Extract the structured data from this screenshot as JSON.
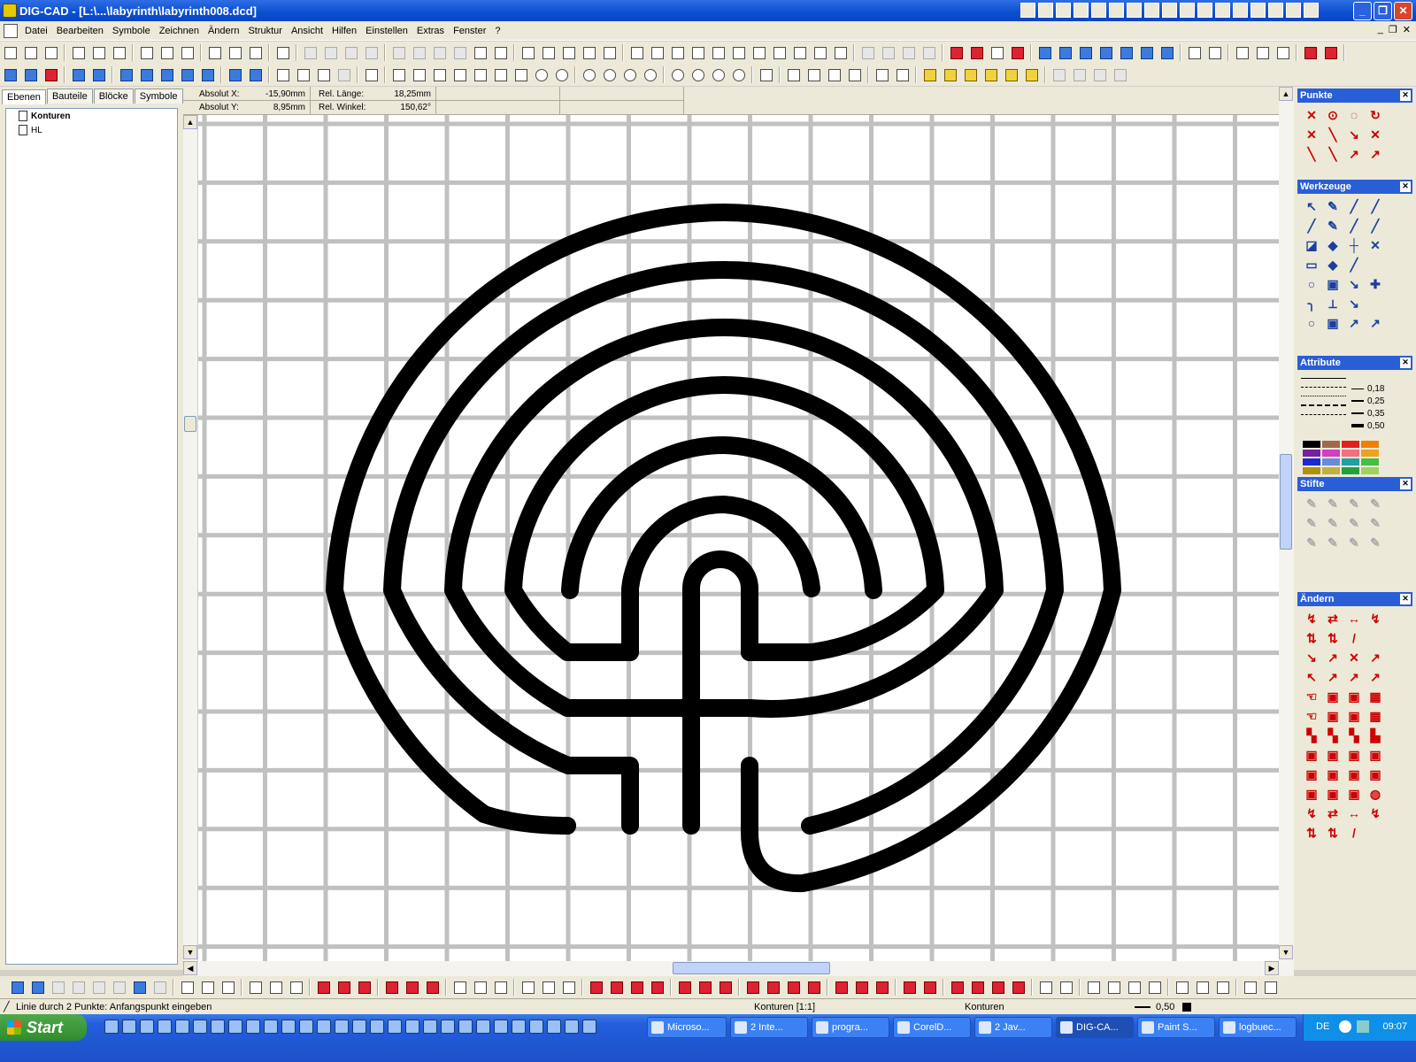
{
  "window": {
    "title": "DIG-CAD - [L:\\...\\labyrinth\\labyrinth008.dcd]"
  },
  "menu": [
    "Datei",
    "Bearbeiten",
    "Symbole",
    "Zeichnen",
    "Ändern",
    "Struktur",
    "Ansicht",
    "Hilfen",
    "Einstellen",
    "Extras",
    "Fenster",
    "?"
  ],
  "left_panel": {
    "tabs": [
      "Ebenen",
      "Bauteile",
      "Blöcke",
      "Symbole"
    ],
    "active_tab": "Ebenen",
    "layers": [
      "Konturen",
      "HL"
    ]
  },
  "coords": {
    "abs_x_label": "Absolut X:",
    "abs_x_value": "-15,90mm",
    "abs_y_label": "Absolut Y:",
    "abs_y_value": "8,95mm",
    "rel_len_label": "Rel. Länge:",
    "rel_len_value": "18,25mm",
    "rel_angle_label": "Rel. Winkel:",
    "rel_angle_value": "150,62°"
  },
  "right_panels": {
    "punkte": "Punkte",
    "werkzeuge": "Werkzeuge",
    "attribute": "Attribute",
    "stifte": "Stifte",
    "aendern": "Ändern",
    "line_widths": [
      "0,18",
      "0,25",
      "0,35",
      "0,50"
    ],
    "colors": [
      "#000000",
      "#a06a4a",
      "#e02020",
      "#f08000",
      "#7a1ea0",
      "#d040c0",
      "#f07080",
      "#f0a020",
      "#1a2ad0",
      "#6a8ad8",
      "#20a0a0",
      "#40c040",
      "#b09010",
      "#c0b040",
      "#20a040",
      "#a0d060"
    ]
  },
  "status": {
    "hint": "Linie durch 2 Punkte: Anfangspunkt eingeben",
    "layer_scale": "Konturen [1:1]",
    "layer": "Konturen",
    "linewidth": "0,50"
  },
  "taskbar": {
    "start": "Start",
    "tasks": [
      "Microso...",
      "2 Inte...",
      "progra...",
      "CorelD...",
      "2 Jav...",
      "DIG-CA...",
      "Paint S...",
      "logbuec..."
    ],
    "active_task": "DIG-CA...",
    "lang": "DE",
    "time": "09:07"
  }
}
